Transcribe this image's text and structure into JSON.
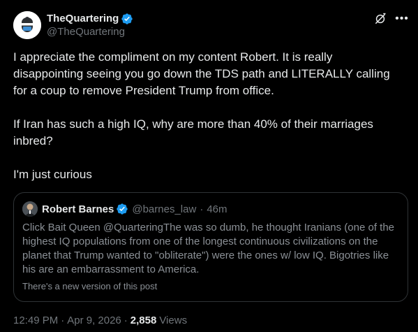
{
  "author": {
    "display_name": "TheQuartering",
    "handle": "@TheQuartering",
    "verified": true,
    "avatar_icon": "qmark-logo-icon"
  },
  "colors": {
    "background": "#000000",
    "text": "#e7e9ea",
    "muted": "#71767b",
    "verified_blue": "#1d9bf0",
    "border": "#2f3336"
  },
  "body": {
    "paragraphs": [
      "I appreciate the compliment on my content Robert.  It is really disappointing seeing you go down the TDS path and LITERALLY calling for a coup to remove President Trump from office.",
      "If Iran has such a high IQ, why are more than 40% of their marriages inbred?",
      "I'm just curious"
    ]
  },
  "quote": {
    "display_name": "Robert Barnes",
    "handle": "@barnes_law",
    "separator": "·",
    "time": "46m",
    "text": "Click Bait Queen @QuarteringThe was so dumb, he thought Iranians (one of the highest IQ populations from one of the longest continuous civilizations on the planet that Trump wanted to \"obliterate\") were the ones w/ low IQ. Bigotries like his are an embarrassment to America.",
    "note": "There's a new version of this post"
  },
  "footer": {
    "time": "12:49 PM",
    "separator": "·",
    "date": "Apr 9, 2026",
    "views_count": "2,858",
    "views_label": "Views"
  }
}
